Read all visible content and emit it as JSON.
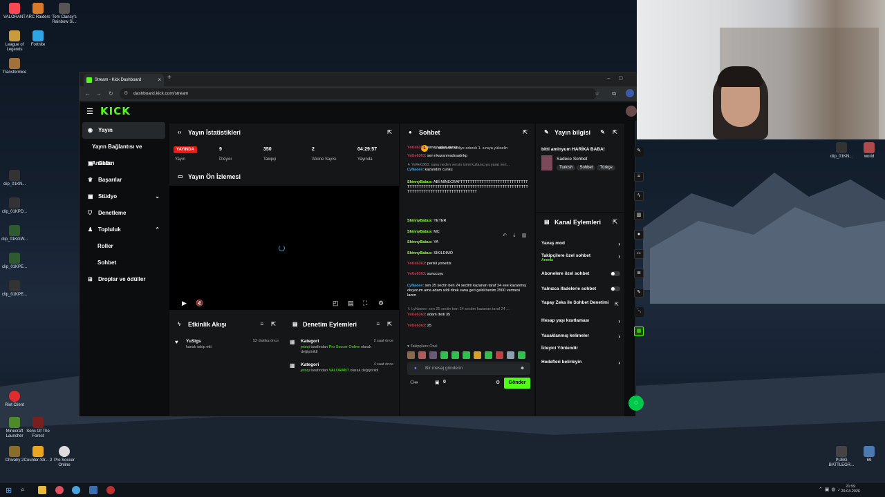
{
  "desktop": {
    "icons": [
      {
        "label": "VALORANT"
      },
      {
        "label": "ARC Raiders"
      },
      {
        "label": "Tom Clancy's Rainbow Si..."
      },
      {
        "label": "League of Legends"
      },
      {
        "label": "Fortnite"
      },
      {
        "label": "Transformice"
      },
      {
        "label": "clip_01KN..."
      },
      {
        "label": "clip_01KPD..."
      },
      {
        "label": "clip_01KGW..."
      },
      {
        "label": "clip_01KPE..."
      },
      {
        "label": "clip_01KPE..."
      },
      {
        "label": "Riot Client"
      },
      {
        "label": "Minecraft Launcher"
      },
      {
        "label": "Sons Of The Forest"
      },
      {
        "label": "Chivalry 2"
      },
      {
        "label": "Counter-Str... 2"
      },
      {
        "label": "Pro Soccer Online"
      },
      {
        "label": "clip_01KN..."
      },
      {
        "label": "world"
      },
      {
        "label": "PUBG BATTLEGR..."
      },
      {
        "label": "69"
      }
    ]
  },
  "browser": {
    "tab_title": "Stream - Kick Dashboard",
    "url": "dashboard.kick.com/stream"
  },
  "kick": {
    "logo": "KICK"
  },
  "sidebar": {
    "items": [
      {
        "label": "Yayın"
      },
      {
        "label": "Yayın Bağlantısı ve Anahtarı"
      },
      {
        "label": "Gelir"
      },
      {
        "label": "Başarılar"
      },
      {
        "label": "Stüdyo"
      },
      {
        "label": "Denetleme"
      },
      {
        "label": "Topluluk"
      },
      {
        "label": "Roller"
      },
      {
        "label": "Sohbet"
      },
      {
        "label": "Droplar ve ödüller"
      }
    ]
  },
  "stats_panel": {
    "title": "Yayın İstatistikleri",
    "live_badge": "YAYINDA",
    "stats": [
      {
        "value": "",
        "label": "Yayın"
      },
      {
        "value": "9",
        "label": "İzleyici"
      },
      {
        "value": "350",
        "label": "Takipçi"
      },
      {
        "value": "2",
        "label": "Abone Sayısı"
      },
      {
        "value": "04:29:57",
        "label": "Yayında"
      }
    ]
  },
  "preview_panel": {
    "title": "Yayın Ön İzlemesi"
  },
  "activity_panel": {
    "title": "Etkinlik Akışı",
    "event": {
      "user": "YuSigs",
      "time": "52 dakika önce",
      "text": "kanalı takip etti"
    }
  },
  "mod_panel": {
    "title": "Denetim Eylemleri",
    "events": [
      {
        "title": "Kategori",
        "time": "2 saat önce",
        "user": "jetsqi",
        "pre": "tarafından",
        "value": "Pro Soccer Online",
        "post": "olarak değiştirildi"
      },
      {
        "title": "Kategori",
        "time": "4 saat önce",
        "user": "jetsqi",
        "pre": "tarafından",
        "value": "VALORANT",
        "post": "olarak değiştirildi"
      }
    ]
  },
  "chat": {
    "title": "Sohbet",
    "banner": "1 abonelik hediye ederek 1. sıraya yükselin",
    "coin": "1",
    "messages": [
      {
        "user": "YeKe6363",
        "text": "sana neden versin",
        "cls": "red"
      },
      {
        "user": "YeKe6363",
        "text": "sen nkazanmadısadnkp",
        "cls": "red"
      },
      {
        "user": "",
        "text": "↳ YeKe6363: sana neden versin isimi kullanıcıya yarat veri...",
        "cls": "reply"
      },
      {
        "user": "LyNaeee",
        "text": "kazandım cunku",
        "cls": "blu"
      },
      {
        "user": "ShinnyBabus",
        "text": "ABİ MİNECRAFTTTTTTTTTTTTTTTTTTTTTTTTTTTTTTTTTTTTTTTTTTTTTTTTTTTTTTTTTTTTTTTTTTTTTTTTTTTTTTTTTTTTTTTTTTTTTTTTTTTTTTTTTTTTTTT",
        "cls": "lime"
      },
      {
        "user": "ShinnyBabus",
        "text": "YETER",
        "cls": "lime"
      },
      {
        "user": "ShinnyBabus",
        "text": "MC",
        "cls": "lime"
      },
      {
        "user": "ShinnyBabus",
        "text": "YA",
        "cls": "lime"
      },
      {
        "user": "ShinnyBabus",
        "text": "SİKILDIMÖ",
        "cls": "lime"
      },
      {
        "user": "YeKe6363",
        "text": "perisli yonettis",
        "cls": "red"
      },
      {
        "user": "YeKe6363",
        "text": "sunucuyu",
        "cls": "red"
      },
      {
        "user": "LyNaeee",
        "text": "sen 25 sectin ben 24 sectim kazanan taraf 24 eee kazanmış oluyorum ama adam sildi direk sana geri geldi benim 2500 vermesi lazım",
        "cls": "blu"
      },
      {
        "user": "",
        "text": "↳ LyNaeee: sen 25 sectin ben 24 sectim kazanan taraf 24 ...",
        "cls": "reply"
      },
      {
        "user": "YeKe6363",
        "text": "adam dedi 35",
        "cls": "red"
      },
      {
        "user": "YeKe6363",
        "text": "25",
        "cls": "red"
      }
    ],
    "followers_only": "Takipçilere Özel",
    "placeholder": "Bir mesaj gönderin",
    "count": "0",
    "send": "Gönder"
  },
  "info_panel": {
    "title": "Yayın bilgisi",
    "stream_title": "bitti aminyum HARİKA BABA!",
    "category": "Sadece Sohbet",
    "tags": [
      "Turkish",
      "Sohbet",
      "Türkçe"
    ]
  },
  "channel_panel": {
    "title": "Kanal Eylemleri",
    "actions": [
      {
        "label": "Yavaş mod",
        "sub": ""
      },
      {
        "label": "Takipçilere özel sohbet",
        "sub": "Anında"
      },
      {
        "label": "Abonelere özel sohbet",
        "sub": ""
      },
      {
        "label": "Yalnızca ifadelerle sohbet",
        "sub": ""
      },
      {
        "label": "Yapay Zeka ile Sohbet Denetimi",
        "sub": ""
      },
      {
        "label": "Hesap yaşı kısıtlaması",
        "sub": ""
      },
      {
        "label": "Yasaklanmış kelimeler",
        "sub": ""
      },
      {
        "label": "İzleyici Yönlendir",
        "sub": ""
      },
      {
        "label": "Hedefleri belirleyin",
        "sub": ""
      }
    ]
  },
  "taskbar": {
    "time": "21:59",
    "date": "29.04.2026"
  }
}
